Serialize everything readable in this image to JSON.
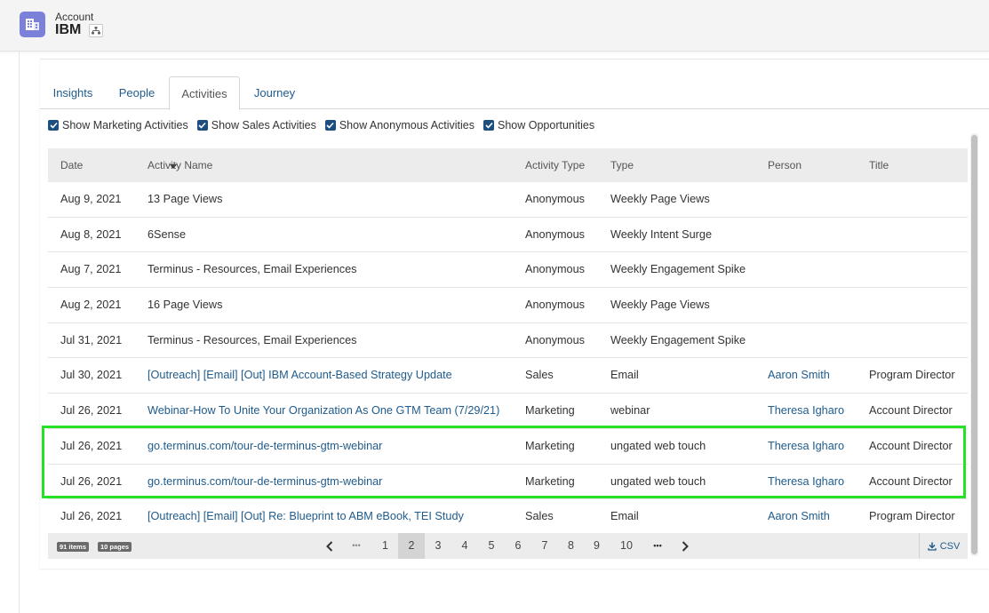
{
  "header": {
    "label": "Account",
    "name": "IBM"
  },
  "tabs": [
    {
      "label": "Insights"
    },
    {
      "label": "People"
    },
    {
      "label": "Activities"
    },
    {
      "label": "Journey"
    }
  ],
  "filters": [
    {
      "label": "Show Marketing Activities",
      "checked": true
    },
    {
      "label": "Show Sales Activities",
      "checked": true
    },
    {
      "label": "Show Anonymous Activities",
      "checked": true
    },
    {
      "label": "Show Opportunities",
      "checked": true
    }
  ],
  "table": {
    "columns": [
      "Date",
      "Activity Name",
      "Activity Type",
      "Type",
      "Person",
      "Title"
    ],
    "rows": [
      {
        "date": "Aug 9, 2021",
        "name": "13 Page Views",
        "atype": "Anonymous",
        "type": "Weekly Page Views",
        "person": "",
        "title": ""
      },
      {
        "date": "Aug 8, 2021",
        "name": "6Sense",
        "atype": "Anonymous",
        "type": "Weekly Intent Surge",
        "person": "",
        "title": ""
      },
      {
        "date": "Aug 7, 2021",
        "name": "Terminus - Resources, Email Experiences",
        "atype": "Anonymous",
        "type": "Weekly Engagement Spike",
        "person": "",
        "title": ""
      },
      {
        "date": "Aug 2, 2021",
        "name": "16 Page Views",
        "atype": "Anonymous",
        "type": "Weekly Page Views",
        "person": "",
        "title": ""
      },
      {
        "date": "Jul 31, 2021",
        "name": "Terminus - Resources, Email Experiences",
        "atype": "Anonymous",
        "type": "Weekly Engagement Spike",
        "person": "",
        "title": ""
      },
      {
        "date": "Jul 30, 2021",
        "name": "[Outreach] [Email] [Out] IBM Account-Based Strategy Update",
        "atype": "Sales",
        "type": "Email",
        "person": "Aaron Smith",
        "title": "Program Director"
      },
      {
        "date": "Jul 26, 2021",
        "name": "Webinar-How To Unite Your Organization As One GTM Team (7/29/21)",
        "atype": "Marketing",
        "type": "webinar",
        "person": "Theresa Igharo",
        "title": "Account Director"
      },
      {
        "date": "Jul 26, 2021",
        "name": "go.terminus.com/tour-de-terminus-gtm-webinar",
        "atype": "Marketing",
        "type": "ungated web touch",
        "person": "Theresa Igharo",
        "title": "Account Director"
      },
      {
        "date": "Jul 26, 2021",
        "name": "go.terminus.com/tour-de-terminus-gtm-webinar",
        "atype": "Marketing",
        "type": "ungated web touch",
        "person": "Theresa Igharo",
        "title": "Account Director"
      },
      {
        "date": "Jul 26, 2021",
        "name": "[Outreach] [Email] [Out] Re: Blueprint to ABM eBook, TEI Study",
        "atype": "Sales",
        "type": "Email",
        "person": "Aaron Smith",
        "title": "Program Director"
      }
    ]
  },
  "pager": {
    "items_badge": "91 items",
    "pages_badge": "10 pages",
    "pages": [
      "1",
      "2",
      "3",
      "4",
      "5",
      "6",
      "7",
      "8",
      "9",
      "10"
    ],
    "current": "2",
    "ellipsis": "•••",
    "csv_label": "CSV"
  },
  "colors": {
    "link": "#1f5b8c",
    "accent": "#7b80d8",
    "highlight": "#27e127",
    "checkbox": "#1c4f80"
  }
}
